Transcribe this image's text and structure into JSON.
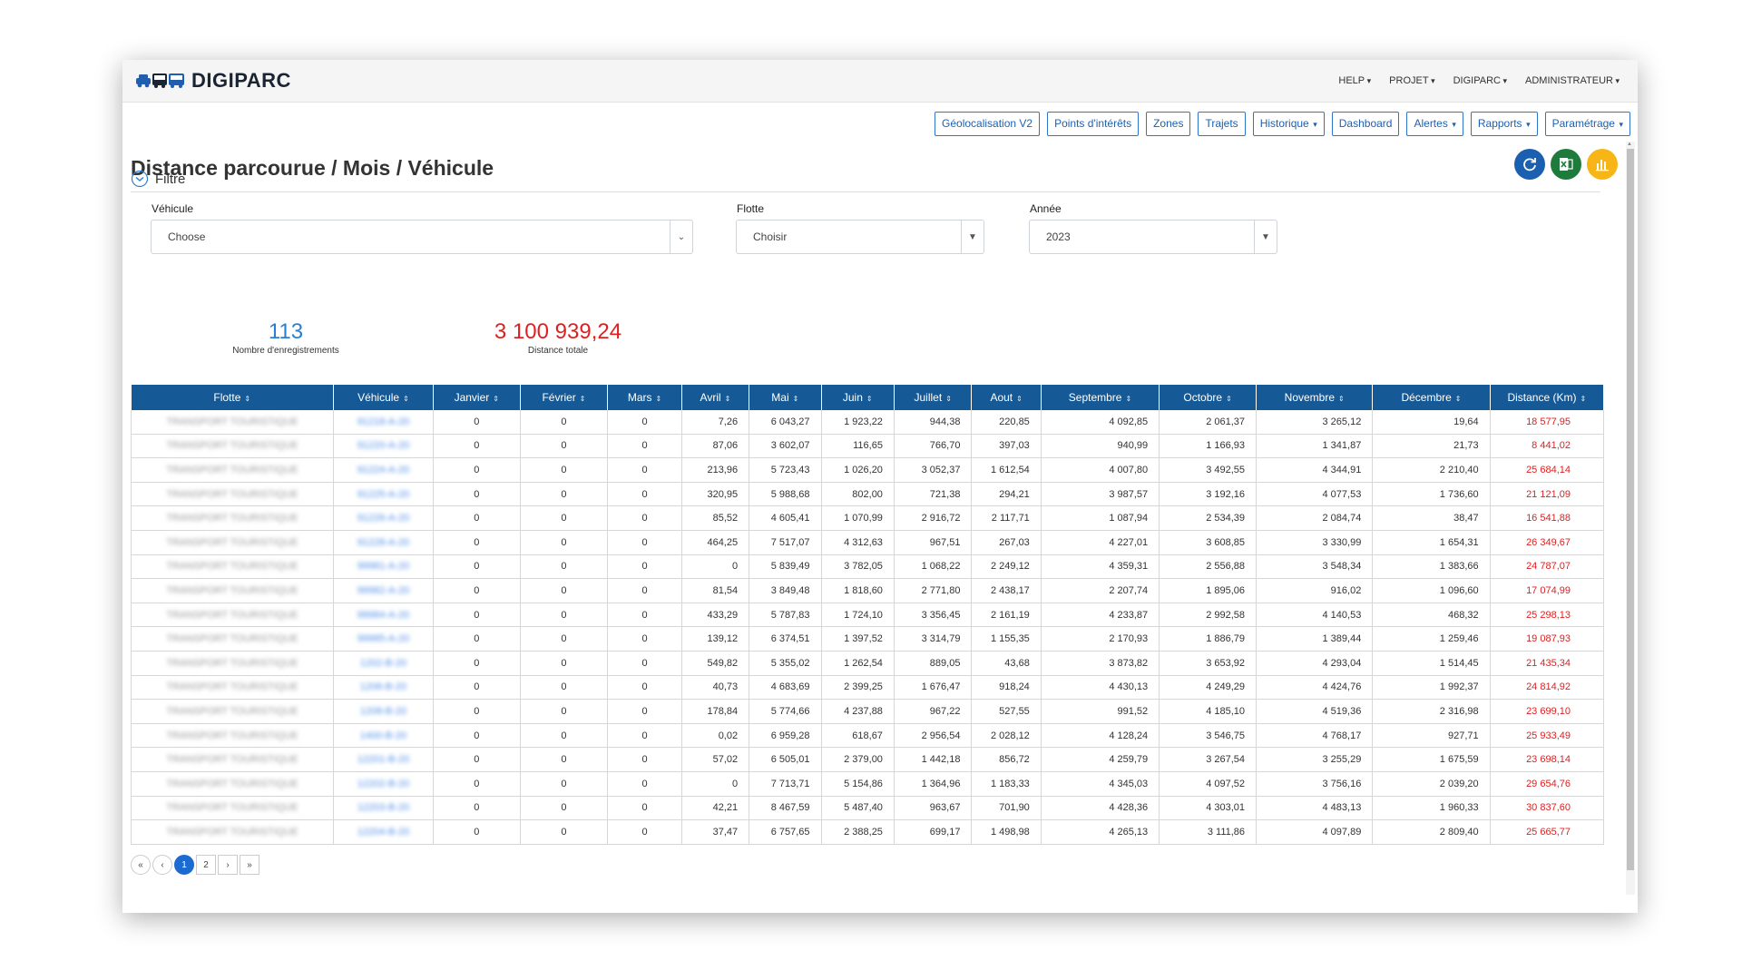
{
  "app": {
    "name": "DIGIPARC"
  },
  "topmenu": [
    "HELP",
    "PROJET",
    "DIGIPARC",
    "ADMINISTRATEUR"
  ],
  "nav": [
    {
      "label": "Géolocalisation V2",
      "dropdown": false
    },
    {
      "label": "Points d'intérêts",
      "dropdown": false
    },
    {
      "label": "Zones",
      "dropdown": false
    },
    {
      "label": "Trajets",
      "dropdown": false
    },
    {
      "label": "Historique",
      "dropdown": true
    },
    {
      "label": "Dashboard",
      "dropdown": false
    },
    {
      "label": "Alertes",
      "dropdown": true
    },
    {
      "label": "Rapports",
      "dropdown": true
    },
    {
      "label": "Paramétrage",
      "dropdown": true
    }
  ],
  "page": {
    "title": "Distance parcourue / Mois / Véhicule"
  },
  "actions": [
    {
      "icon": "refresh-icon",
      "color": "#1b5fb0"
    },
    {
      "icon": "excel-icon",
      "color": "#1e7b3b"
    },
    {
      "icon": "chart-icon",
      "color": "#f7b516"
    }
  ],
  "filter": {
    "label": "Filtre",
    "vehicule": {
      "label": "Véhicule",
      "value": "Choose"
    },
    "flotte": {
      "label": "Flotte",
      "value": "Choisir"
    },
    "annee": {
      "label": "Année",
      "value": "2023"
    }
  },
  "stats": {
    "count": {
      "value": "113",
      "label": "Nombre d'enregistrements",
      "color": "#2a7fd4"
    },
    "total": {
      "value": "3 100 939,24",
      "label": "Distance totale",
      "color": "#e02020"
    }
  },
  "table": {
    "headers": [
      "Flotte",
      "Véhicule",
      "Janvier",
      "Février",
      "Mars",
      "Avril",
      "Mai",
      "Juin",
      "Juillet",
      "Aout",
      "Septembre",
      "Octobre",
      "Novembre",
      "Décembre",
      "Distance (Km)"
    ],
    "rows": [
      [
        "TRANSPORT TOURISTIQUE",
        "91218-A-20",
        "0",
        "0",
        "0",
        "7,26",
        "6 043,27",
        "1 923,22",
        "944,38",
        "220,85",
        "4 092,85",
        "2 061,37",
        "3 265,12",
        "19,64",
        "18 577,95"
      ],
      [
        "TRANSPORT TOURISTIQUE",
        "91220-A-20",
        "0",
        "0",
        "0",
        "87,06",
        "3 602,07",
        "116,65",
        "766,70",
        "397,03",
        "940,99",
        "1 166,93",
        "1 341,87",
        "21,73",
        "8 441,02"
      ],
      [
        "TRANSPORT TOURISTIQUE",
        "91224-A-20",
        "0",
        "0",
        "0",
        "213,96",
        "5 723,43",
        "1 026,20",
        "3 052,37",
        "1 612,54",
        "4 007,80",
        "3 492,55",
        "4 344,91",
        "2 210,40",
        "25 684,14"
      ],
      [
        "TRANSPORT TOURISTIQUE",
        "91225-A-20",
        "0",
        "0",
        "0",
        "320,95",
        "5 988,68",
        "802,00",
        "721,38",
        "294,21",
        "3 987,57",
        "3 192,16",
        "4 077,53",
        "1 736,60",
        "21 121,09"
      ],
      [
        "TRANSPORT TOURISTIQUE",
        "91226-A-20",
        "0",
        "0",
        "0",
        "85,52",
        "4 605,41",
        "1 070,99",
        "2 916,72",
        "2 117,71",
        "1 087,94",
        "2 534,39",
        "2 084,74",
        "38,47",
        "16 541,88"
      ],
      [
        "TRANSPORT TOURISTIQUE",
        "91228-A-20",
        "0",
        "0",
        "0",
        "464,25",
        "7 517,07",
        "4 312,63",
        "967,51",
        "267,03",
        "4 227,01",
        "3 608,85",
        "3 330,99",
        "1 654,31",
        "26 349,67"
      ],
      [
        "TRANSPORT TOURISTIQUE",
        "99981-A-20",
        "0",
        "0",
        "0",
        "0",
        "5 839,49",
        "3 782,05",
        "1 068,22",
        "2 249,12",
        "4 359,31",
        "2 556,88",
        "3 548,34",
        "1 383,66",
        "24 787,07"
      ],
      [
        "TRANSPORT TOURISTIQUE",
        "99982-A-20",
        "0",
        "0",
        "0",
        "81,54",
        "3 849,48",
        "1 818,60",
        "2 771,80",
        "2 438,17",
        "2 207,74",
        "1 895,06",
        "916,02",
        "1 096,60",
        "17 074,99"
      ],
      [
        "TRANSPORT TOURISTIQUE",
        "99984-A-20",
        "0",
        "0",
        "0",
        "433,29",
        "5 787,83",
        "1 724,10",
        "3 356,45",
        "2 161,19",
        "4 233,87",
        "2 992,58",
        "4 140,53",
        "468,32",
        "25 298,13"
      ],
      [
        "TRANSPORT TOURISTIQUE",
        "99985-A-20",
        "0",
        "0",
        "0",
        "139,12",
        "6 374,51",
        "1 397,52",
        "3 314,79",
        "1 155,35",
        "2 170,93",
        "1 886,79",
        "1 389,44",
        "1 259,46",
        "19 087,93"
      ],
      [
        "TRANSPORT TOURISTIQUE",
        "1202-B-20",
        "0",
        "0",
        "0",
        "549,82",
        "5 355,02",
        "1 262,54",
        "889,05",
        "43,68",
        "3 873,82",
        "3 653,92",
        "4 293,04",
        "1 514,45",
        "21 435,34"
      ],
      [
        "TRANSPORT TOURISTIQUE",
        "1206-B-20",
        "0",
        "0",
        "0",
        "40,73",
        "4 683,69",
        "2 399,25",
        "1 676,47",
        "918,24",
        "4 430,13",
        "4 249,29",
        "4 424,76",
        "1 992,37",
        "24 814,92"
      ],
      [
        "TRANSPORT TOURISTIQUE",
        "1208-B-20",
        "0",
        "0",
        "0",
        "178,84",
        "5 774,66",
        "4 237,88",
        "967,22",
        "527,55",
        "991,52",
        "4 185,10",
        "4 519,36",
        "2 316,98",
        "23 699,10"
      ],
      [
        "TRANSPORT TOURISTIQUE",
        "1400-B-20",
        "0",
        "0",
        "0",
        "0,02",
        "6 959,28",
        "618,67",
        "2 956,54",
        "2 028,12",
        "4 128,24",
        "3 546,75",
        "4 768,17",
        "927,71",
        "25 933,49"
      ],
      [
        "TRANSPORT TOURISTIQUE",
        "12201-B-20",
        "0",
        "0",
        "0",
        "57,02",
        "6 505,01",
        "2 379,00",
        "1 442,18",
        "856,72",
        "4 259,79",
        "3 267,54",
        "3 255,29",
        "1 675,59",
        "23 698,14"
      ],
      [
        "TRANSPORT TOURISTIQUE",
        "12202-B-20",
        "0",
        "0",
        "0",
        "0",
        "7 713,71",
        "5 154,86",
        "1 364,96",
        "1 183,33",
        "4 345,03",
        "4 097,52",
        "3 756,16",
        "2 039,20",
        "29 654,76"
      ],
      [
        "TRANSPORT TOURISTIQUE",
        "12203-B-20",
        "0",
        "0",
        "0",
        "42,21",
        "8 467,59",
        "5 487,40",
        "963,67",
        "701,90",
        "4 428,36",
        "4 303,01",
        "4 483,13",
        "1 960,33",
        "30 837,60"
      ],
      [
        "TRANSPORT TOURISTIQUE",
        "12204-B-20",
        "0",
        "0",
        "0",
        "37,47",
        "6 757,65",
        "2 388,25",
        "699,17",
        "1 498,98",
        "4 265,13",
        "3 111,86",
        "4 097,89",
        "2 809,40",
        "25 665,77"
      ]
    ]
  },
  "pagination": {
    "pages": [
      "1",
      "2"
    ],
    "current": "1"
  }
}
